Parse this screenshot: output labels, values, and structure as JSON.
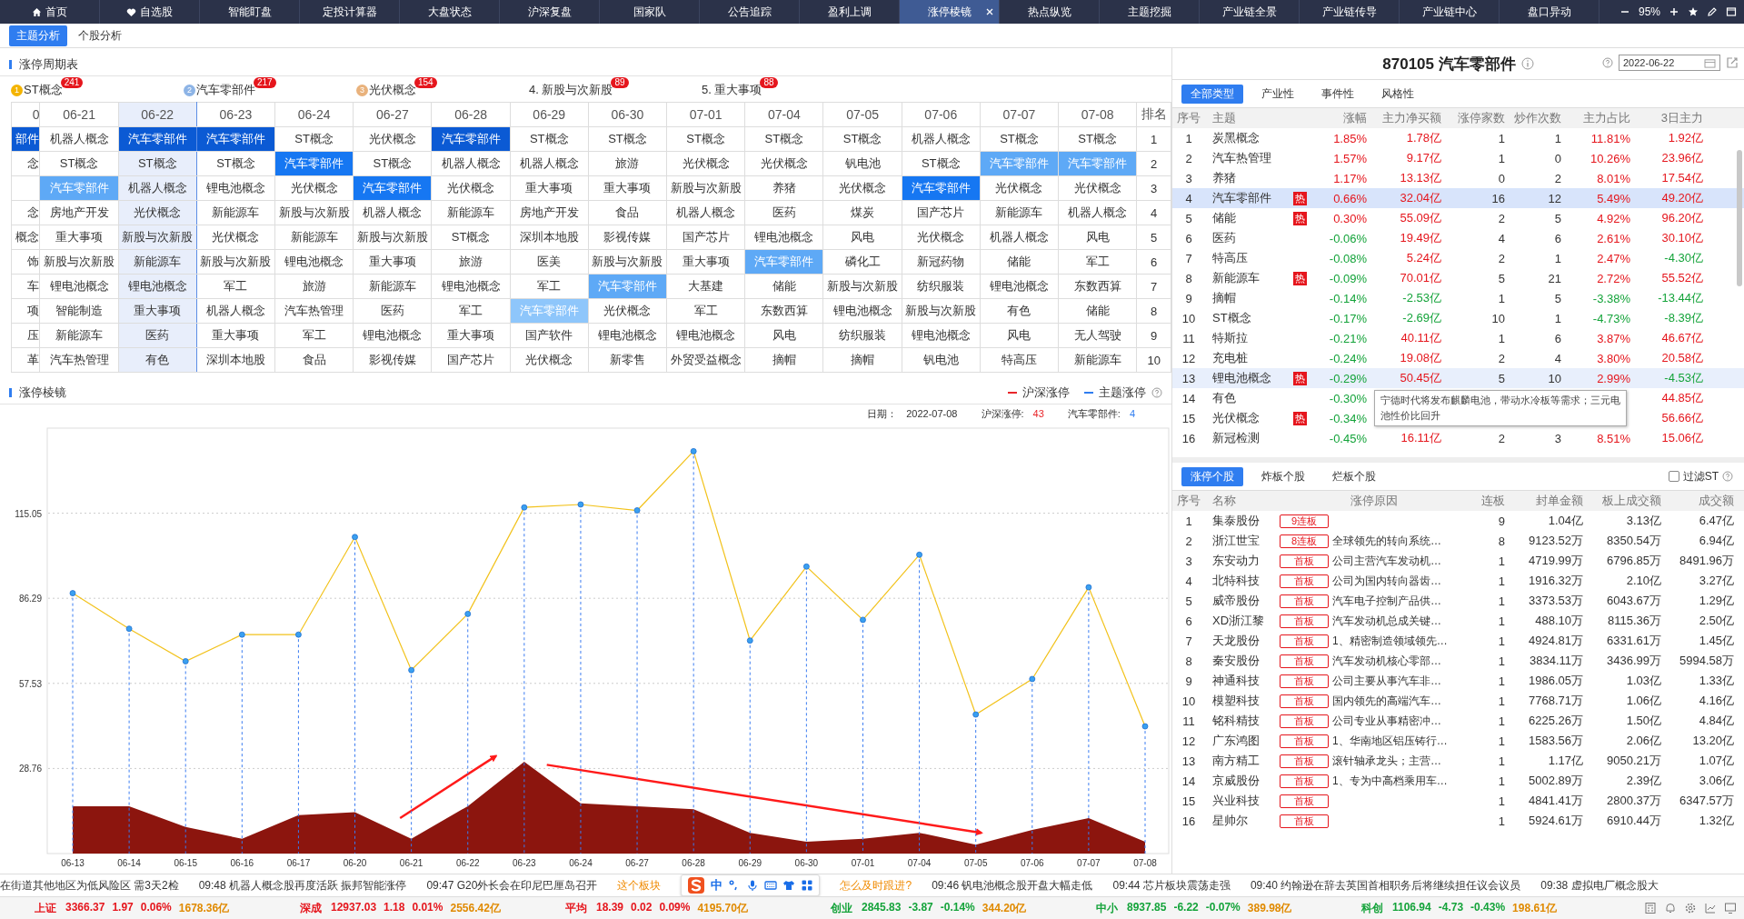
{
  "nav": {
    "tabs": [
      {
        "label": "首页",
        "selected": false
      },
      {
        "label": "自选股",
        "selected": false
      },
      {
        "label": "智能盯盘",
        "selected": false
      },
      {
        "label": "定投计算器",
        "selected": false
      },
      {
        "label": "大盘状态",
        "selected": false
      },
      {
        "label": "沪深复盘",
        "selected": false
      },
      {
        "label": "国家队",
        "selected": false
      },
      {
        "label": "公告追踪",
        "selected": false
      },
      {
        "label": "盈利上调",
        "selected": false
      },
      {
        "label": "涨停棱镜",
        "selected": true,
        "closable": true
      },
      {
        "label": "热点纵览",
        "selected": false
      },
      {
        "label": "主题挖掘",
        "selected": false
      },
      {
        "label": "产业链全景",
        "selected": false
      },
      {
        "label": "产业链传导",
        "selected": false
      },
      {
        "label": "产业链中心",
        "selected": false
      },
      {
        "label": "盘口异动",
        "selected": false
      }
    ],
    "zoom": "95%"
  },
  "subtabs": [
    {
      "label": "主题分析",
      "selected": true
    },
    {
      "label": "个股分析",
      "selected": false
    }
  ],
  "cycle_table": {
    "title": "涨停周期表",
    "leaders": [
      {
        "kind": "medal",
        "rank": "1",
        "label": "ST概念",
        "count": "241"
      },
      {
        "kind": "medal",
        "rank": "2",
        "label": "汽车零部件",
        "count": "217"
      },
      {
        "kind": "medal",
        "rank": "3",
        "label": "光伏概念",
        "count": "154"
      },
      {
        "kind": "plain",
        "label": "4. 新股与次新股",
        "count": "89"
      },
      {
        "kind": "plain",
        "label": "5. 重大事项",
        "count": "88"
      }
    ],
    "columns": [
      {
        "label": "0",
        "selected": false
      },
      {
        "label": "06-21",
        "selected": false
      },
      {
        "label": "06-22",
        "selected": true
      },
      {
        "label": "06-23",
        "selected": false
      },
      {
        "label": "06-24",
        "selected": false
      },
      {
        "label": "06-27",
        "selected": false
      },
      {
        "label": "06-28",
        "selected": false
      },
      {
        "label": "06-29",
        "selected": false
      },
      {
        "label": "06-30",
        "selected": false
      },
      {
        "label": "07-01",
        "selected": false
      },
      {
        "label": "07-04",
        "selected": false
      },
      {
        "label": "07-05",
        "selected": false
      },
      {
        "label": "07-06",
        "selected": false
      },
      {
        "label": "07-07",
        "selected": false
      },
      {
        "label": "07-08",
        "selected": false
      }
    ],
    "rank_header": "排名",
    "rows": [
      {
        "rank": "1",
        "cells": [
          {
            "text": "部件",
            "color": "#0b5ad4"
          },
          {
            "text": "机器人概念"
          },
          {
            "text": "汽车零部件",
            "color": "#0b5ad4"
          },
          {
            "text": "汽车零部件",
            "color": "#0b5ad4"
          },
          {
            "text": "ST概念"
          },
          {
            "text": "光伏概念"
          },
          {
            "text": "汽车零部件",
            "color": "#0b5ad4"
          },
          {
            "text": "ST概念"
          },
          {
            "text": "ST概念"
          },
          {
            "text": "ST概念"
          },
          {
            "text": "ST概念"
          },
          {
            "text": "ST概念"
          },
          {
            "text": "机器人概念"
          },
          {
            "text": "ST概念"
          },
          {
            "text": "ST概念"
          }
        ]
      },
      {
        "rank": "2",
        "cells": [
          {
            "text": "念"
          },
          {
            "text": "ST概念"
          },
          {
            "text": "ST概念"
          },
          {
            "text": "ST概念"
          },
          {
            "text": "汽车零部件",
            "color": "#1677f2"
          },
          {
            "text": "ST概念"
          },
          {
            "text": "机器人概念"
          },
          {
            "text": "机器人概念"
          },
          {
            "text": "旅游"
          },
          {
            "text": "光伏概念"
          },
          {
            "text": "光伏概念"
          },
          {
            "text": "钒电池"
          },
          {
            "text": "ST概念"
          },
          {
            "text": "汽车零部件",
            "color": "#5ea9f6"
          },
          {
            "text": "汽车零部件",
            "color": "#5ea9f6"
          }
        ]
      },
      {
        "rank": "3",
        "cells": [
          {},
          {
            "text": "汽车零部件",
            "color": "#5ea9f6"
          },
          {
            "text": "机器人概念"
          },
          {
            "text": "锂电池概念"
          },
          {
            "text": "光伏概念"
          },
          {
            "text": "汽车零部件",
            "color": "#1677f2"
          },
          {
            "text": "光伏概念"
          },
          {
            "text": "重大事项"
          },
          {
            "text": "重大事项"
          },
          {
            "text": "新股与次新股"
          },
          {
            "text": "养猪"
          },
          {
            "text": "光伏概念"
          },
          {
            "text": "汽车零部件",
            "color": "#1677f2"
          },
          {
            "text": "光伏概念"
          },
          {
            "text": "光伏概念"
          }
        ]
      },
      {
        "rank": "4",
        "cells": [
          {
            "text": "念"
          },
          {
            "text": "房地产开发"
          },
          {
            "text": "光伏概念"
          },
          {
            "text": "新能源车"
          },
          {
            "text": "新股与次新股"
          },
          {
            "text": "机器人概念"
          },
          {
            "text": "新能源车"
          },
          {
            "text": "房地产开发"
          },
          {
            "text": "食品"
          },
          {
            "text": "机器人概念"
          },
          {
            "text": "医药"
          },
          {
            "text": "煤炭"
          },
          {
            "text": "国产芯片"
          },
          {
            "text": "新能源车"
          },
          {
            "text": "机器人概念"
          }
        ]
      },
      {
        "rank": "5",
        "cells": [
          {
            "text": "概念"
          },
          {
            "text": "重大事项"
          },
          {
            "text": "新股与次新股"
          },
          {
            "text": "光伏概念"
          },
          {
            "text": "新能源车"
          },
          {
            "text": "新股与次新股"
          },
          {
            "text": "ST概念"
          },
          {
            "text": "深圳本地股"
          },
          {
            "text": "影视传媒"
          },
          {
            "text": "国产芯片"
          },
          {
            "text": "锂电池概念"
          },
          {
            "text": "风电"
          },
          {
            "text": "光伏概念"
          },
          {
            "text": "机器人概念"
          },
          {
            "text": "风电"
          }
        ]
      },
      {
        "rank": "6",
        "cells": [
          {
            "text": "饰"
          },
          {
            "text": "新股与次新股"
          },
          {
            "text": "新能源车"
          },
          {
            "text": "新股与次新股"
          },
          {
            "text": "锂电池概念"
          },
          {
            "text": "重大事项"
          },
          {
            "text": "旅游"
          },
          {
            "text": "医美"
          },
          {
            "text": "新股与次新股"
          },
          {
            "text": "重大事项"
          },
          {
            "text": "汽车零部件",
            "color": "#5ea9f6"
          },
          {
            "text": "磷化工"
          },
          {
            "text": "新冠药物"
          },
          {
            "text": "储能"
          },
          {
            "text": "军工"
          }
        ]
      },
      {
        "rank": "7",
        "cells": [
          {
            "text": "车"
          },
          {
            "text": "锂电池概念"
          },
          {
            "text": "锂电池概念"
          },
          {
            "text": "军工"
          },
          {
            "text": "旅游"
          },
          {
            "text": "新能源车"
          },
          {
            "text": "锂电池概念"
          },
          {
            "text": "军工"
          },
          {
            "text": "汽车零部件",
            "color": "#5ea9f6"
          },
          {
            "text": "大基建"
          },
          {
            "text": "储能"
          },
          {
            "text": "新股与次新股"
          },
          {
            "text": "纺织服装"
          },
          {
            "text": "锂电池概念"
          },
          {
            "text": "东数西算"
          }
        ]
      },
      {
        "rank": "8",
        "cells": [
          {
            "text": "项"
          },
          {
            "text": "智能制造"
          },
          {
            "text": "重大事项"
          },
          {
            "text": "机器人概念"
          },
          {
            "text": "汽车热管理"
          },
          {
            "text": "医药"
          },
          {
            "text": "军工"
          },
          {
            "text": "汽车零部件",
            "color": "#8ec6fb"
          },
          {
            "text": "光伏概念"
          },
          {
            "text": "军工"
          },
          {
            "text": "东数西算"
          },
          {
            "text": "锂电池概念"
          },
          {
            "text": "新股与次新股"
          },
          {
            "text": "有色"
          },
          {
            "text": "储能"
          }
        ]
      },
      {
        "rank": "9",
        "cells": [
          {
            "text": "压"
          },
          {
            "text": "新能源车"
          },
          {
            "text": "医药"
          },
          {
            "text": "重大事项"
          },
          {
            "text": "军工"
          },
          {
            "text": "锂电池概念"
          },
          {
            "text": "重大事项"
          },
          {
            "text": "国产软件"
          },
          {
            "text": "锂电池概念"
          },
          {
            "text": "锂电池概念"
          },
          {
            "text": "风电"
          },
          {
            "text": "纺织服装"
          },
          {
            "text": "锂电池概念"
          },
          {
            "text": "风电"
          },
          {
            "text": "无人驾驶"
          }
        ]
      },
      {
        "rank": "10",
        "cells": [
          {
            "text": "革"
          },
          {
            "text": "汽车热管理"
          },
          {
            "text": "有色"
          },
          {
            "text": "深圳本地股"
          },
          {
            "text": "食品"
          },
          {
            "text": "影视传媒"
          },
          {
            "text": "国产芯片"
          },
          {
            "text": "光伏概念"
          },
          {
            "text": "新零售"
          },
          {
            "text": "外贸受益概念"
          },
          {
            "text": "摘帽"
          },
          {
            "text": "摘帽"
          },
          {
            "text": "钒电池"
          },
          {
            "text": "特高压"
          },
          {
            "text": "新能源车"
          }
        ]
      }
    ]
  },
  "prism": {
    "title": "涨停棱镜",
    "legend": [
      {
        "color": "#e8262a"
      },
      {
        "color": "#2f7df0"
      }
    ],
    "info": [
      {
        "label": "日期：",
        "value": "2022-07-08",
        "color": "#333333"
      },
      {
        "label": "沪深涨停:",
        "value": "43",
        "color": "#e8262a"
      },
      {
        "label": "汽车零部件:",
        "value": "4",
        "color": "#2f7df0"
      }
    ],
    "chart_data": {
      "type": "line",
      "categories": [
        "06-13",
        "06-14",
        "06-15",
        "06-16",
        "06-17",
        "06-20",
        "06-21",
        "06-22",
        "06-23",
        "06-24",
        "06-27",
        "06-28",
        "06-29",
        "06-30",
        "07-01",
        "07-04",
        "07-05",
        "07-06",
        "07-07",
        "07-08"
      ],
      "series": [
        {
          "name": "沪深涨停",
          "type": "line",
          "marker": true,
          "color": "#f2c21b",
          "values": [
            88,
            76,
            65,
            74,
            74,
            107,
            62,
            81,
            117,
            118,
            116,
            136,
            72,
            97,
            79,
            101,
            47,
            59,
            90,
            43
          ]
        },
        {
          "name": "主题涨停",
          "type": "area",
          "color": "#8c150e",
          "values": [
            16,
            16,
            9,
            5,
            13,
            14,
            5,
            16,
            31,
            17,
            16,
            15,
            7,
            4,
            5,
            7,
            3,
            8,
            12,
            4
          ]
        }
      ],
      "ylim": [
        0,
        143.8
      ],
      "grid": true,
      "yticks": [
        {
          "value": 28.76,
          "label": "28.76"
        },
        {
          "value": 57.53,
          "label": "57.53"
        },
        {
          "value": 86.29,
          "label": "86.29"
        },
        {
          "value": 115.05,
          "label": "115.05"
        }
      ]
    }
  },
  "theme_panel": {
    "title": "870105 汽车零部件",
    "date": "2022-06-22",
    "tabs": [
      {
        "label": "全部类型",
        "selected": true
      },
      {
        "label": "产业性",
        "selected": false
      },
      {
        "label": "事件性",
        "selected": false
      },
      {
        "label": "风格性",
        "selected": false
      }
    ],
    "columns": [
      "序号",
      "主题",
      "涨幅",
      "主力净买额",
      "涨停家数",
      "炒作次数",
      "主力占比",
      "3日主力"
    ],
    "rows": [
      {
        "no": "1",
        "name": "炭黑概念",
        "selected": false,
        "hovered": false,
        "change": "1.85%",
        "net_buy": "1.78亿",
        "limit_count": "1",
        "hype_count": "1",
        "ratio": "11.81%",
        "three_day": "1.92亿"
      },
      {
        "no": "2",
        "name": "汽车热管理",
        "selected": false,
        "hovered": false,
        "change": "1.57%",
        "net_buy": "9.17亿",
        "limit_count": "1",
        "hype_count": "0",
        "ratio": "10.26%",
        "three_day": "23.96亿"
      },
      {
        "no": "3",
        "name": "养猪",
        "selected": false,
        "hovered": false,
        "change": "1.17%",
        "net_buy": "13.13亿",
        "limit_count": "0",
        "hype_count": "2",
        "ratio": "8.01%",
        "three_day": "17.54亿"
      },
      {
        "no": "4",
        "name": "汽车零部件",
        "hot": "热",
        "selected": true,
        "hovered": false,
        "change": "0.66%",
        "net_buy": "32.04亿",
        "limit_count": "16",
        "hype_count": "12",
        "ratio": "5.49%",
        "three_day": "49.20亿"
      },
      {
        "no": "5",
        "name": "储能",
        "hot": "热",
        "selected": false,
        "hovered": false,
        "change": "0.30%",
        "net_buy": "55.09亿",
        "limit_count": "2",
        "hype_count": "5",
        "ratio": "4.92%",
        "three_day": "96.20亿"
      },
      {
        "no": "6",
        "name": "医药",
        "selected": false,
        "hovered": false,
        "change": "-0.06%",
        "net_buy": "19.49亿",
        "limit_count": "4",
        "hype_count": "6",
        "ratio": "2.61%",
        "three_day": "30.10亿"
      },
      {
        "no": "7",
        "name": "特高压",
        "selected": false,
        "hovered": false,
        "change": "-0.08%",
        "net_buy": "5.24亿",
        "limit_count": "2",
        "hype_count": "1",
        "ratio": "2.47%",
        "three_day": "-4.30亿"
      },
      {
        "no": "8",
        "name": "新能源车",
        "hot": "热",
        "selected": false,
        "hovered": false,
        "change": "-0.09%",
        "net_buy": "70.01亿",
        "limit_count": "5",
        "hype_count": "21",
        "ratio": "2.72%",
        "three_day": "55.52亿"
      },
      {
        "no": "9",
        "name": "摘帽",
        "selected": false,
        "hovered": false,
        "change": "-0.14%",
        "net_buy": "-2.53亿",
        "limit_count": "1",
        "hype_count": "5",
        "ratio": "-3.38%",
        "three_day": "-13.44亿"
      },
      {
        "no": "10",
        "name": "ST概念",
        "selected": false,
        "hovered": false,
        "change": "-0.17%",
        "net_buy": "-2.69亿",
        "limit_count": "10",
        "hype_count": "1",
        "ratio": "-4.73%",
        "three_day": "-8.39亿"
      },
      {
        "no": "11",
        "name": "特斯拉",
        "selected": false,
        "hovered": false,
        "change": "-0.21%",
        "net_buy": "40.11亿",
        "limit_count": "1",
        "hype_count": "6",
        "ratio": "3.87%",
        "three_day": "46.67亿"
      },
      {
        "no": "12",
        "name": "充电桩",
        "selected": false,
        "hovered": false,
        "change": "-0.24%",
        "net_buy": "19.08亿",
        "limit_count": "2",
        "hype_count": "4",
        "ratio": "3.80%",
        "three_day": "20.58亿"
      },
      {
        "no": "13",
        "name": "锂电池概念",
        "hot": "热",
        "selected": false,
        "hovered": true,
        "change": "-0.29%",
        "net_buy": "50.45亿",
        "limit_count": "5",
        "hype_count": "10",
        "ratio": "2.99%",
        "three_day": "-4.53亿"
      },
      {
        "no": "14",
        "name": "有色",
        "selected": false,
        "hovered": false,
        "change": "-0.30%",
        "three_day": "44.85亿"
      },
      {
        "no": "15",
        "name": "光伏概念",
        "hot": "热",
        "selected": false,
        "hovered": false,
        "change": "-0.34%",
        "three_day": "56.66亿"
      },
      {
        "no": "16",
        "name": "新冠检测",
        "selected": false,
        "hovered": false,
        "change": "-0.45%",
        "net_buy": "16.11亿",
        "limit_count": "2",
        "hype_count": "3",
        "ratio": "8.51%",
        "three_day": "15.06亿"
      }
    ],
    "tooltip": "宁德时代将发布麒麟电池，带动水冷板等需求；三元电池性价比回升"
  },
  "stock_panel": {
    "tabs": [
      {
        "label": "涨停个股",
        "selected": true
      },
      {
        "label": "炸板个股",
        "selected": false
      },
      {
        "label": "烂板个股",
        "selected": false
      }
    ],
    "filter": {
      "label": "过滤ST",
      "checked": false
    },
    "columns": [
      "序号",
      "名称",
      "涨停原因",
      "连板",
      "封单金额",
      "板上成交额",
      "成交额"
    ],
    "rows": [
      {
        "no": "1",
        "name": "集泰股份",
        "badge": "9连板",
        "values": [
          "9",
          "1.04亿",
          "3.13亿",
          "6.47亿"
        ]
      },
      {
        "no": "2",
        "name": "浙江世宝",
        "badge": "8连板",
        "reason": "全球领先的转向系统…",
        "values": [
          "8",
          "9123.52万",
          "8350.54万",
          "6.94亿"
        ]
      },
      {
        "no": "3",
        "name": "东安动力",
        "badge": "首板",
        "reason": "公司主营汽车发动机…",
        "values": [
          "1",
          "4719.99万",
          "6796.85万",
          "8491.96万"
        ]
      },
      {
        "no": "4",
        "name": "北特科技",
        "badge": "首板",
        "reason": "公司为国内转向器齿…",
        "values": [
          "1",
          "1916.32万",
          "2.10亿",
          "3.27亿"
        ]
      },
      {
        "no": "5",
        "name": "威帝股份",
        "badge": "首板",
        "reason": "汽车电子控制产品供…",
        "values": [
          "1",
          "3373.53万",
          "6043.67万",
          "1.29亿"
        ]
      },
      {
        "no": "6",
        "name": "XD浙江黎",
        "badge": "首板",
        "reason": "汽车发动机总成关键…",
        "values": [
          "1",
          "488.10万",
          "8115.36万",
          "2.50亿"
        ]
      },
      {
        "no": "7",
        "name": "天龙股份",
        "badge": "首板",
        "reason": "1、精密制造领域领先…",
        "values": [
          "1",
          "4924.81万",
          "6331.61万",
          "1.45亿"
        ]
      },
      {
        "no": "8",
        "name": "秦安股份",
        "badge": "首板",
        "reason": "汽车发动机核心零部…",
        "values": [
          "1",
          "3834.11万",
          "3436.99万",
          "5994.58万"
        ]
      },
      {
        "no": "9",
        "name": "神通科技",
        "badge": "首板",
        "reason": "公司主要从事汽车非…",
        "values": [
          "1",
          "1986.05万",
          "1.03亿",
          "1.33亿"
        ]
      },
      {
        "no": "10",
        "name": "模塑科技",
        "badge": "首板",
        "reason": "国内领先的高端汽车…",
        "values": [
          "1",
          "7768.71万",
          "1.06亿",
          "4.16亿"
        ]
      },
      {
        "no": "11",
        "name": "铭科精技",
        "badge": "首板",
        "reason": "公司专业从事精密冲…",
        "values": [
          "1",
          "6225.26万",
          "1.50亿",
          "4.84亿"
        ]
      },
      {
        "no": "12",
        "name": "广东鸿图",
        "badge": "首板",
        "reason": "1、华南地区铝压铸行…",
        "values": [
          "1",
          "1583.56万",
          "2.06亿",
          "13.20亿"
        ]
      },
      {
        "no": "13",
        "name": "南方精工",
        "badge": "首板",
        "reason": "滚针轴承龙头；主营…",
        "values": [
          "1",
          "1.17亿",
          "9050.21万",
          "1.07亿"
        ]
      },
      {
        "no": "14",
        "name": "京威股份",
        "badge": "首板",
        "reason": "1、专为中高档乘用车…",
        "values": [
          "1",
          "5002.89万",
          "2.39亿",
          "3.06亿"
        ]
      },
      {
        "no": "15",
        "name": "兴业科技",
        "badge": "首板",
        "values": [
          "1",
          "4841.41万",
          "2800.37万",
          "6347.57万"
        ]
      },
      {
        "no": "16",
        "name": "星帅尔",
        "badge": "首板",
        "values": [
          "1",
          "5924.61万",
          "6910.44万",
          "1.32亿"
        ]
      }
    ]
  },
  "ticker": [
    {
      "kind": "news",
      "text": "在街道其他地区为低风险区 需3天2检"
    },
    {
      "kind": "news",
      "text": "09:48 机器人概念股再度活跃 振邦智能涨停"
    },
    {
      "kind": "news",
      "text": "09:47 G20外长会在印尼巴厘岛召开"
    },
    {
      "kind": "promo",
      "text": "这个板块"
    },
    {
      "kind": "ime",
      "mode": "中"
    },
    {
      "kind": "promo",
      "text": "怎么及时跟进?"
    },
    {
      "kind": "news",
      "text": "09:46 钒电池概念股开盘大幅走低"
    },
    {
      "kind": "news",
      "text": "09:44 芯片板块震荡走强"
    },
    {
      "kind": "news",
      "text": "09:40 约翰逊在辞去英国首相职务后将继续担任议会议员"
    },
    {
      "kind": "news",
      "text": "09:38 虚拟电厂概念股大"
    }
  ],
  "indices": [
    {
      "name": "上证",
      "price": "3366.37",
      "change": "1.97",
      "pct": "0.06%",
      "amount": "1678.36亿",
      "up": true
    },
    {
      "name": "深成",
      "price": "12937.03",
      "change": "1.18",
      "pct": "0.01%",
      "amount": "2556.42亿",
      "up": true
    },
    {
      "name": "平均",
      "price": "18.39",
      "change": "0.02",
      "pct": "0.09%",
      "amount": "4195.70亿",
      "up": true
    },
    {
      "name": "创业",
      "price": "2845.83",
      "change": "-3.87",
      "pct": "-0.14%",
      "amount": "344.20亿",
      "up": false
    },
    {
      "name": "中小",
      "price": "8937.85",
      "change": "-6.22",
      "pct": "-0.07%",
      "amount": "389.98亿",
      "up": false
    },
    {
      "name": "科创",
      "price": "1106.94",
      "change": "-4.73",
      "pct": "-0.43%",
      "amount": "198.61亿",
      "up": false
    }
  ]
}
